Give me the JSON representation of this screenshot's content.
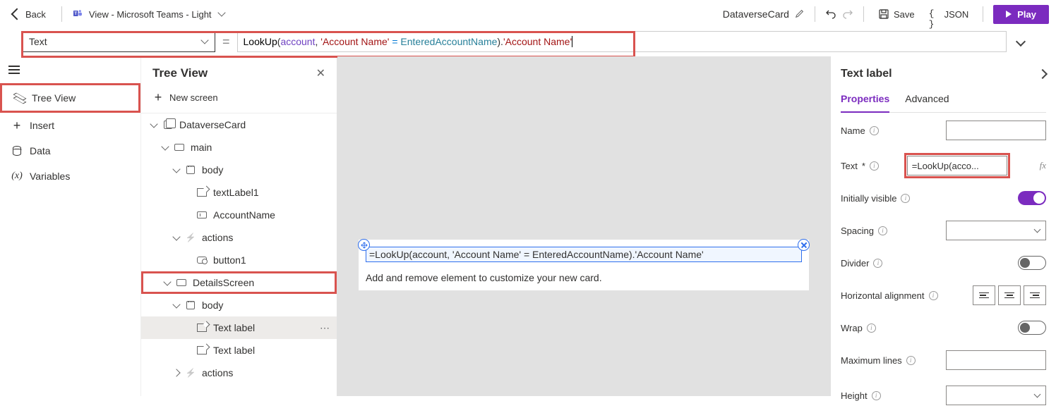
{
  "toolbar": {
    "back": "Back",
    "view_label": "View - Microsoft Teams - Light",
    "app_title": "DataverseCard",
    "save": "Save",
    "json": "JSON",
    "play": "Play"
  },
  "formula_bar": {
    "property": "Text",
    "tokens": {
      "fn_lookup": "LookUp",
      "open": "(",
      "datasource": "account",
      "comma": ", ",
      "field1_q": "'Account Name'",
      "eq": " = ",
      "variable": "EnteredAccountName",
      "close": ").",
      "field2_q": "'Account Name'"
    }
  },
  "nav": {
    "tree_view": "Tree View",
    "insert": "Insert",
    "data": "Data",
    "variables": "Variables"
  },
  "tree_view": {
    "title": "Tree View",
    "new_screen": "New screen",
    "nodes": {
      "root": "DataverseCard",
      "main": "main",
      "body1": "body",
      "textlabel1": "textLabel1",
      "accountname": "AccountName",
      "actions1": "actions",
      "button1": "button1",
      "detailsscreen": "DetailsScreen",
      "body2": "body",
      "textlabel_sel": "Text label",
      "textlabel3": "Text label",
      "actions2": "actions"
    }
  },
  "canvas": {
    "selected_text": "=LookUp(account, 'Account Name' = EnteredAccountName).'Account Name'",
    "placeholder": "Add and remove element to customize your new card."
  },
  "props": {
    "title": "Text label",
    "tab_properties": "Properties",
    "tab_advanced": "Advanced",
    "name": "Name",
    "text": "Text",
    "text_value": "=LookUp(acco...",
    "initially_visible": "Initially visible",
    "spacing": "Spacing",
    "divider": "Divider",
    "horizontal_alignment": "Horizontal alignment",
    "wrap": "Wrap",
    "maximum_lines": "Maximum lines",
    "height": "Height"
  }
}
